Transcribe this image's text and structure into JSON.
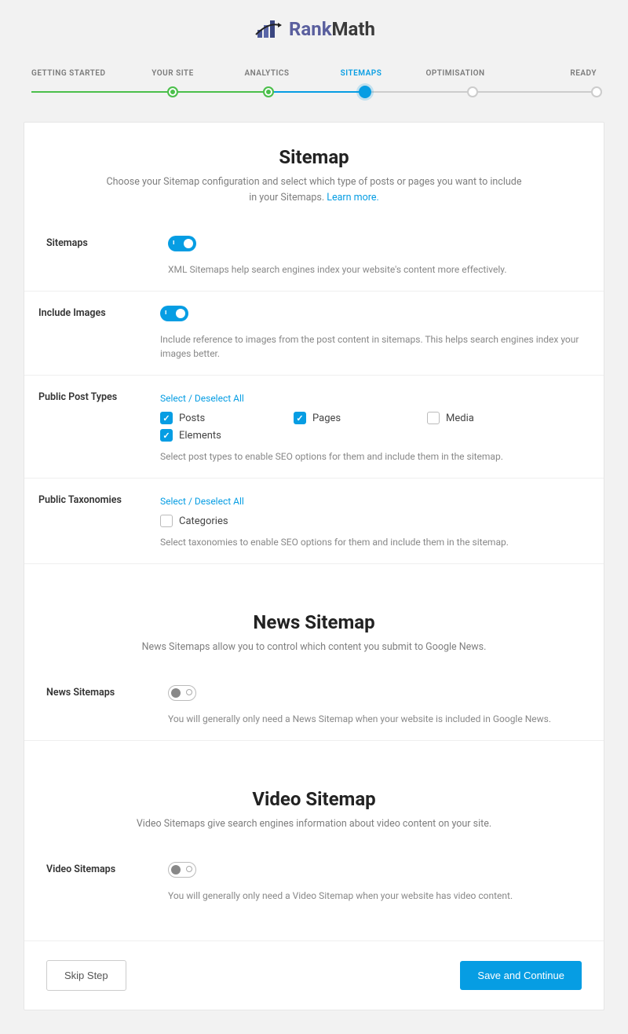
{
  "brand": {
    "rank": "Rank",
    "math": "Math"
  },
  "wizard": {
    "steps": [
      "GETTING STARTED",
      "YOUR SITE",
      "ANALYTICS",
      "SITEMAPS",
      "OPTIMISATION",
      "READY"
    ]
  },
  "section1": {
    "title": "Sitemap",
    "desc": "Choose your Sitemap configuration and select which type of posts or pages you want to include in your Sitemaps. ",
    "learn": "Learn more."
  },
  "fields": {
    "sitemaps": {
      "label": "Sitemaps",
      "desc": "XML Sitemaps help search engines index your website's content more effectively."
    },
    "images": {
      "label": "Include Images",
      "desc": "Include reference to images from the post content in sitemaps. This helps search engines index your images better."
    },
    "postTypes": {
      "label": "Public Post Types",
      "selectAll": "Select / Deselect All",
      "opts": {
        "posts": "Posts",
        "media": "Media",
        "pages": "Pages",
        "elements": "Elements"
      },
      "desc": "Select post types to enable SEO options for them and include them in the sitemap."
    },
    "tax": {
      "label": "Public Taxonomies",
      "selectAll": "Select / Deselect All",
      "opts": {
        "categories": "Categories"
      },
      "desc": "Select taxonomies to enable SEO options for them and include them in the sitemap."
    }
  },
  "section2": {
    "title": "News Sitemap",
    "desc": "News Sitemaps allow you to control which content you submit to Google News."
  },
  "news": {
    "label": "News Sitemaps",
    "desc": "You will generally only need a News Sitemap when your website is included in Google News."
  },
  "section3": {
    "title": "Video Sitemap",
    "desc": "Video Sitemaps give search engines information about video content on your site."
  },
  "video": {
    "label": "Video Sitemaps",
    "desc": "You will generally only need a Video Sitemap when your website has video content."
  },
  "footer": {
    "skip": "Skip Step",
    "save": "Save and Continue"
  }
}
